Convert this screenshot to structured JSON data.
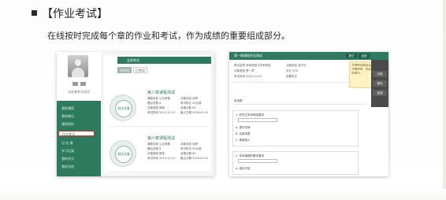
{
  "heading": "【作业考试】",
  "subtitle": "在线按时完成每个章的作业和考试，作为成绩的重要组成部分。",
  "colors": {
    "accent": "#2d7a5f",
    "highlight_border": "#d9302c"
  },
  "left_screenshot": {
    "username": "志愿者考试测试",
    "menu": [
      "我的课程",
      "我的笔记",
      "课程资料",
      "作业考试",
      "讨 论 课",
      "学习记录",
      "我的学分",
      "我的文档"
    ],
    "active_menu_index": 3,
    "top_tab": "全部考试",
    "sub_tabs": [
      "待考试",
      "已考试"
    ],
    "cards": [
      {
        "title": "第八章课程测试",
        "seal": "测试试卷",
        "fields": [
          "课程名称  公共考核",
          "题目总数  8",
          "试卷类型  期末",
          "考试时间  2015-12-01",
          "试卷状态  待考",
          "考试时长  30分钟",
          "及格分数  60",
          "截止日期  2016-01-01"
        ]
      },
      {
        "title": "第六章课程测试",
        "seal": "测试试卷",
        "fields": [
          "课程名称  公共考核",
          "题目总数  8",
          "试卷类型  期末",
          "考试时间  2015-12-01",
          "试卷状态  待考",
          "考试时长  30分钟",
          "及格分数  60",
          "截止日期  2016-01-01"
        ]
      }
    ]
  },
  "right_screenshot": {
    "title": "第一章课程作业测试",
    "header_buttons": [
      "提交",
      "返回"
    ],
    "info": [
      "考试名称  科研诚信与学术规范",
      "试卷类型  第一章",
      "考试时间  2015-12-01",
      "试卷状态  进行中",
      "总分  100",
      "答题时长"
    ],
    "section_label": "单选题",
    "questions": [
      {
        "title": "1. 研究生学术规范要求",
        "options": [
          "A. 遵守法律",
          "B. 实事求是",
          "C. 尊重他人"
        ]
      },
      {
        "title": "2. 学术道德的基本要求",
        "options": [
          "A. 诚实守信"
        ]
      }
    ],
    "note": "仔细阅读题目后选择正确答案，完成后点击提交。",
    "tools": [
      "交卷",
      "暂存",
      "返回"
    ]
  }
}
